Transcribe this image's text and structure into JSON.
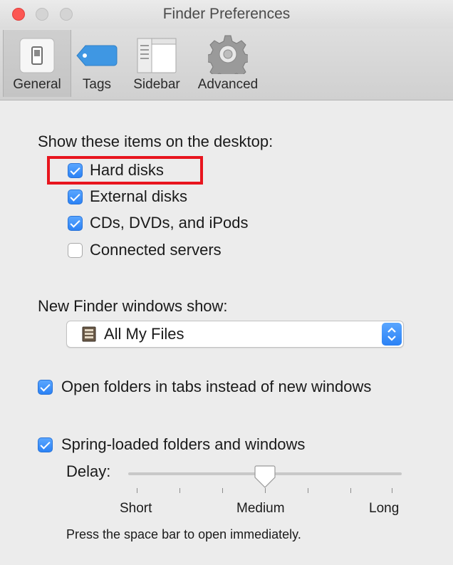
{
  "window": {
    "title": "Finder Preferences"
  },
  "toolbar": {
    "tabs": [
      {
        "label": "General",
        "icon": "general-switch-icon",
        "active": true
      },
      {
        "label": "Tags",
        "icon": "tag-icon",
        "active": false
      },
      {
        "label": "Sidebar",
        "icon": "sidebar-window-icon",
        "active": false
      },
      {
        "label": "Advanced",
        "icon": "gear-icon",
        "active": false
      }
    ]
  },
  "desktop": {
    "heading": "Show these items on the desktop:",
    "items": [
      {
        "label": "Hard disks",
        "checked": true
      },
      {
        "label": "External disks",
        "checked": true
      },
      {
        "label": "CDs, DVDs, and iPods",
        "checked": true
      },
      {
        "label": "Connected servers",
        "checked": false
      }
    ]
  },
  "new_window": {
    "heading": "New Finder windows show:",
    "selected": "All My Files",
    "icon": "all-my-files-icon"
  },
  "open_in_tabs": {
    "label": "Open folders in tabs instead of new windows",
    "checked": true
  },
  "spring_loaded": {
    "label": "Spring-loaded folders and windows",
    "checked": true,
    "delay_label": "Delay:",
    "delay_value": 0.5,
    "ticks": [
      "Short",
      "Medium",
      "Long"
    ],
    "hint": "Press the space bar to open immediately."
  },
  "colors": {
    "accent": "#2b82f5",
    "highlight": "#e8151e"
  }
}
